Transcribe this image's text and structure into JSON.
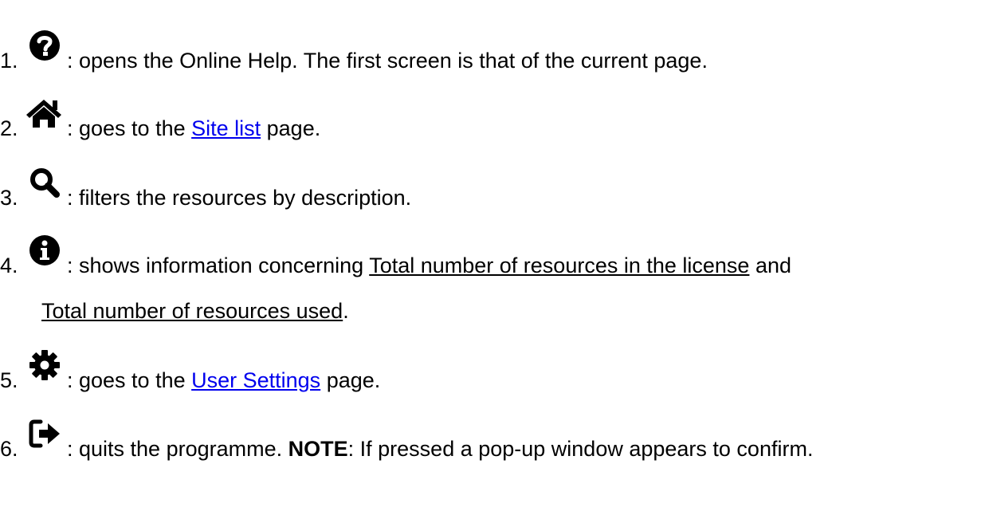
{
  "items": [
    {
      "number": "1.",
      "icon": "question-circle-icon",
      "parts": [
        ": opens the Online Help. The first screen is that of the current page."
      ]
    },
    {
      "number": "2.",
      "icon": "home-icon",
      "parts": [
        ": goes to the ",
        "Site list",
        " page."
      ]
    },
    {
      "number": "3.",
      "icon": "search-icon",
      "parts": [
        ": filters the resources by description."
      ]
    },
    {
      "number": "4.",
      "icon": "info-circle-icon",
      "parts": [
        ": shows information concerning ",
        "Total number of resources in the license",
        " and",
        "Total number of resources used",
        "."
      ]
    },
    {
      "number": "5.",
      "icon": "gear-icon",
      "parts": [
        ": goes to the ",
        "User Settings",
        " page."
      ]
    },
    {
      "number": "6.",
      "icon": "sign-out-icon",
      "parts": [
        ": quits the programme. ",
        "NOTE",
        ": If pressed a pop-up window appears to confirm."
      ]
    }
  ],
  "colors": {
    "text": "#000000",
    "link": "#0000ee",
    "icon": "#000000"
  }
}
